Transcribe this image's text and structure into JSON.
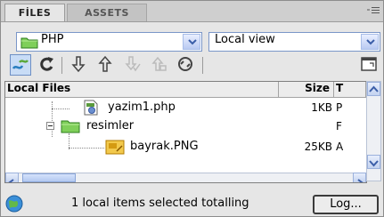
{
  "tabs": [
    {
      "label": "FİLES",
      "active": true
    },
    {
      "label": "ASSETS",
      "active": false
    }
  ],
  "site_select": {
    "value": "PHP",
    "icon": "folder-icon"
  },
  "view_select": {
    "value": "Local view"
  },
  "toolbar": {
    "buttons": [
      {
        "name": "connect-button",
        "icon": "connect-icon",
        "active": true
      },
      {
        "name": "refresh-button",
        "icon": "refresh-icon"
      },
      {
        "name": "get-button",
        "icon": "down-arrow-icon"
      },
      {
        "name": "put-button",
        "icon": "up-arrow-icon"
      },
      {
        "name": "check-out-button",
        "icon": "check-out-icon",
        "disabled": true
      },
      {
        "name": "check-in-button",
        "icon": "check-in-icon",
        "disabled": true
      },
      {
        "name": "synchronize-button",
        "icon": "sync-icon"
      },
      {
        "name": "expand-button",
        "icon": "expand-icon"
      }
    ]
  },
  "file_list": {
    "headers": {
      "name": "Local Files",
      "size": "Size",
      "type": "T"
    },
    "rows": [
      {
        "name": "yazim1.php",
        "size": "1KB",
        "type": "P",
        "icon": "php-file-icon",
        "level": 1
      },
      {
        "name": "resimler",
        "size": "",
        "type": "F",
        "icon": "folder-icon",
        "level": 1,
        "expanded": true
      },
      {
        "name": "bayrak.PNG",
        "size": "25KB",
        "type": "A",
        "icon": "image-file-icon",
        "level": 2,
        "selected": true
      }
    ]
  },
  "status": {
    "text": "1 local items selected totalling",
    "log_button": "Log..."
  },
  "colors": {
    "selection": "#f2c94c",
    "accent": "#7a96c8",
    "panel_bg": "#e6e6e6"
  }
}
